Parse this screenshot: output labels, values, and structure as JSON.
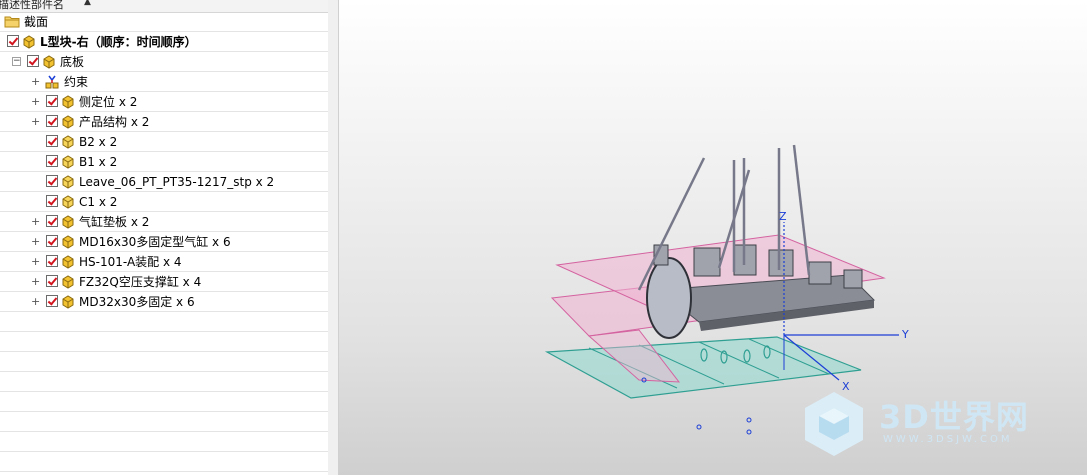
{
  "tree": {
    "header": {
      "column_label": "描述性部件名"
    },
    "rows": [
      {
        "label": "截面",
        "icon": "folder-icon",
        "checkbox": false,
        "expander": "none"
      },
      {
        "label": "L型块-右（顺序：时间顺序）",
        "icon": "assembly-icon",
        "checkbox": true,
        "expander": "collapse",
        "bold": true
      },
      {
        "label": "底板",
        "icon": "assembly-icon",
        "checkbox": true,
        "expander": "collapse"
      },
      {
        "label": "约束",
        "icon": "constraint-icon",
        "checkbox": false,
        "expander": "plus"
      },
      {
        "label": "侧定位 x 2",
        "icon": "assembly-icon",
        "checkbox": true,
        "expander": "plus"
      },
      {
        "label": "产品结构 x 2",
        "icon": "assembly-icon",
        "checkbox": true,
        "expander": "plus"
      },
      {
        "label": "B2 x 2",
        "icon": "part-icon",
        "checkbox": true,
        "expander": "none"
      },
      {
        "label": "B1 x 2",
        "icon": "part-icon",
        "checkbox": true,
        "expander": "none"
      },
      {
        "label": "Leave_06_PT_PT35-1217_stp x 2",
        "icon": "part-icon",
        "checkbox": true,
        "expander": "none"
      },
      {
        "label": "C1 x 2",
        "icon": "part-icon",
        "checkbox": true,
        "expander": "none"
      },
      {
        "label": "气缸垫板 x 2",
        "icon": "assembly-icon",
        "checkbox": true,
        "expander": "plus"
      },
      {
        "label": "MD16x30多固定型气缸 x 6",
        "icon": "assembly-icon",
        "checkbox": true,
        "expander": "plus"
      },
      {
        "label": "HS-101-A装配 x 4",
        "icon": "assembly-icon",
        "checkbox": true,
        "expander": "plus"
      },
      {
        "label": "FZ32Q空压支撑缸 x 4",
        "icon": "assembly-icon",
        "checkbox": true,
        "expander": "plus"
      },
      {
        "label": "MD32x30多固定 x 6",
        "icon": "assembly-icon",
        "checkbox": true,
        "expander": "plus"
      }
    ]
  },
  "viewport": {
    "axes": {
      "x": "X",
      "y": "Y",
      "z": "Z"
    },
    "watermark": {
      "title": "3D世界网",
      "url": "WWW.3DSJW.COM"
    }
  },
  "colors": {
    "check": "#d2141e",
    "pink_plate": "#e58ab9",
    "teal_plate": "#4fc1b4",
    "axis_blue": "#1c3fd6",
    "watermark": "#cfe6f4"
  }
}
